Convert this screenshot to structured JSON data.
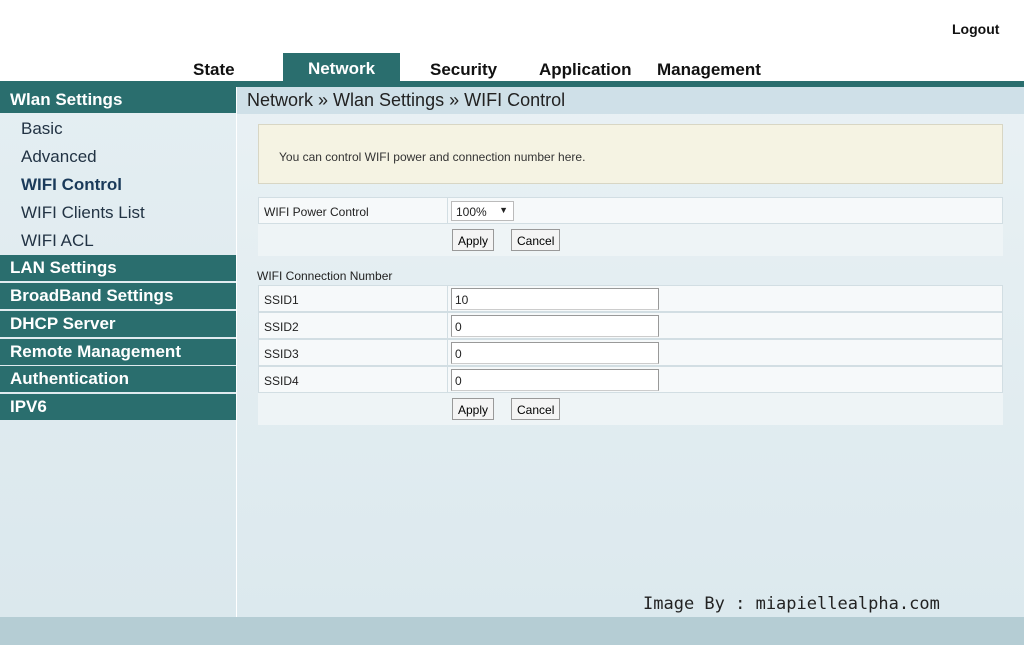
{
  "header": {
    "logout": "Logout",
    "tabs": [
      "State",
      "Network",
      "Security",
      "Application",
      "Management"
    ],
    "active_tab": "Network"
  },
  "sidebar": {
    "sections": [
      "Wlan Settings",
      "LAN Settings",
      "BroadBand Settings",
      "DHCP Server",
      "Remote Management",
      "Authentication",
      "IPV6"
    ],
    "wlan_items": [
      "Basic",
      "Advanced",
      "WIFI Control",
      "WIFI Clients List",
      "WIFI ACL"
    ],
    "active_item": "WIFI Control"
  },
  "breadcrumb": "Network » Wlan Settings » WIFI Control",
  "info": "You can control WIFI power and connection number here.",
  "power": {
    "label": "WIFI Power Control",
    "value": "100%",
    "apply": "Apply",
    "cancel": "Cancel"
  },
  "connection": {
    "title": "WIFI Connection Number",
    "rows": [
      {
        "label": "SSID1",
        "value": "10"
      },
      {
        "label": "SSID2",
        "value": "0"
      },
      {
        "label": "SSID3",
        "value": "0"
      },
      {
        "label": "SSID4",
        "value": "0"
      }
    ],
    "apply": "Apply",
    "cancel": "Cancel"
  },
  "watermark": "Image By : miapiellealpha.com",
  "colors": {
    "brand": "#2a6e6e",
    "info_bg": "#f5f3e3"
  }
}
